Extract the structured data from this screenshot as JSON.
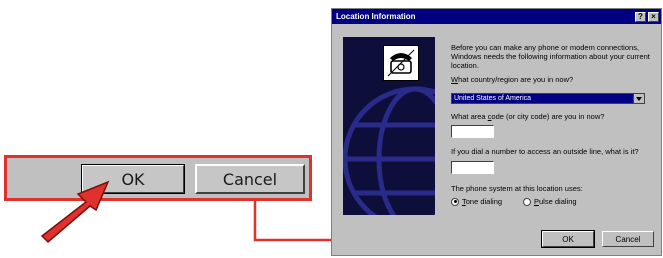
{
  "zoom": {
    "ok_label": "OK",
    "cancel_label": "Cancel"
  },
  "dialog": {
    "title": "Location Information",
    "help_glyph": "?",
    "close_glyph": "×",
    "intro": "Before you can make any phone or modem connections, Windows needs the following information about your current location.",
    "country_label_pre": "",
    "country_label_key": "W",
    "country_label_post": "hat country/region are you in now?",
    "country_value": "United States of America",
    "area_label_pre": "What area ",
    "area_label_key": "c",
    "area_label_post": "ode (or city code) are you in now?",
    "area_value": "",
    "outside_label": "If you dial a number to access an outside line, what is it?",
    "outside_value": "",
    "phone_system_label": "The phone system at this location uses:",
    "tone_key": "T",
    "tone_rest": "one dialing",
    "pulse_key": "P",
    "pulse_rest": "ulse dialing",
    "tone_selected": true,
    "ok_label": "OK",
    "cancel_label": "Cancel"
  },
  "icons": {
    "phone": "telephone-icon",
    "dropdown": "chevron-down-icon"
  },
  "colors": {
    "highlight": "#e0322c",
    "titlebar": "#000080",
    "face": "#c0c0c0"
  }
}
